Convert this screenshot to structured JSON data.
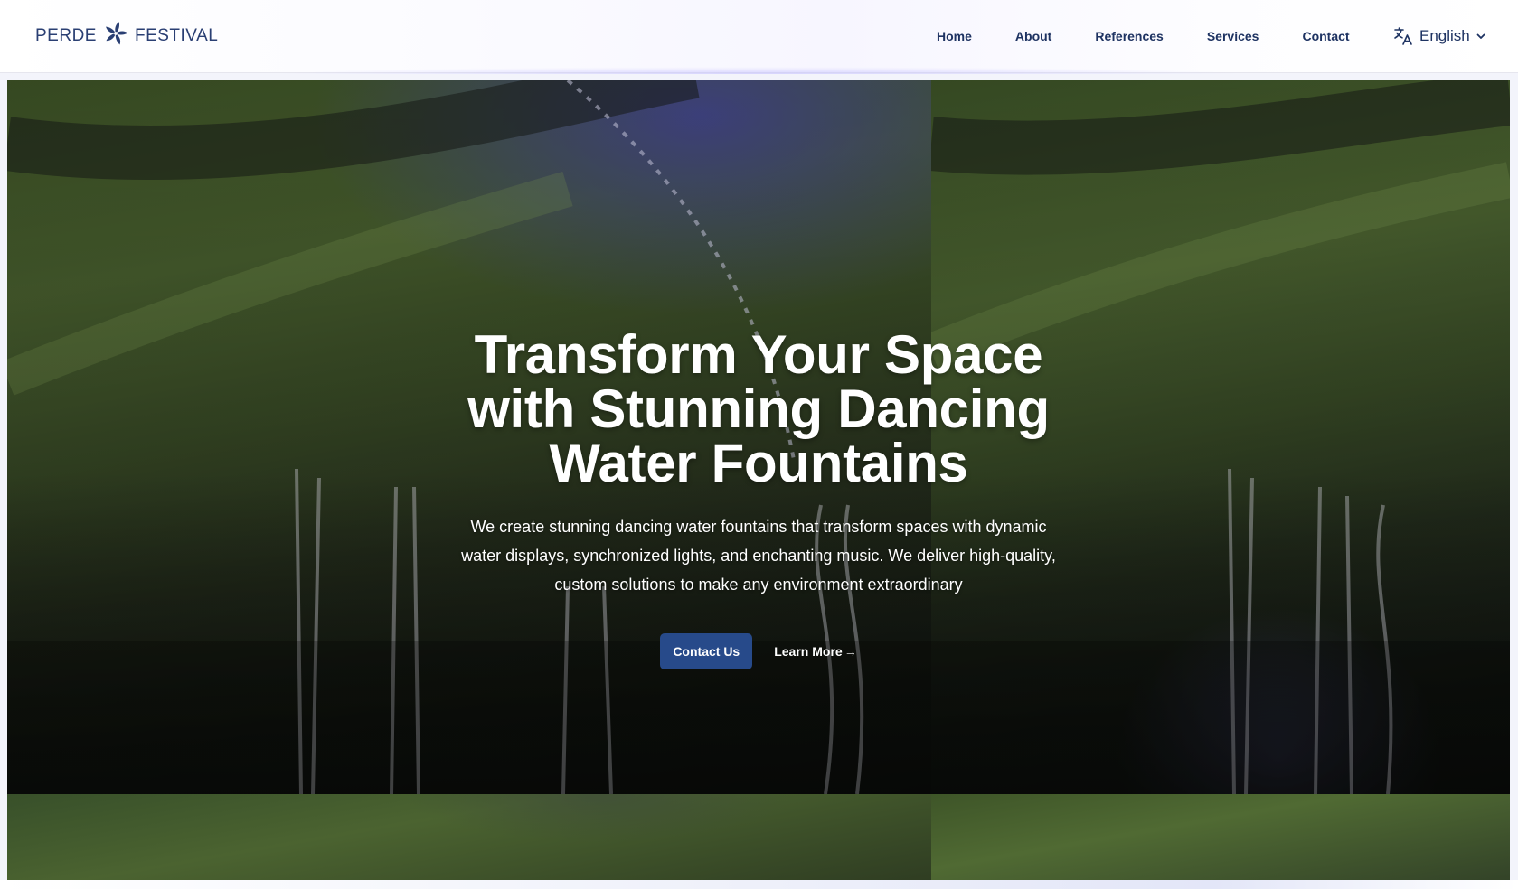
{
  "brand": {
    "left_text": "PERDE",
    "right_text": "FESTIVAL",
    "logo_icon": "pinwheel-flower-icon",
    "color": "#2a3f73"
  },
  "nav": {
    "items": [
      {
        "label": "Home"
      },
      {
        "label": "About"
      },
      {
        "label": "References"
      },
      {
        "label": "Services"
      },
      {
        "label": "Contact"
      }
    ]
  },
  "language": {
    "icon": "translate-icon",
    "selected": "English",
    "dropdown_icon": "chevron-down-icon"
  },
  "hero": {
    "title": "Transform Your Space with Stunning Dancing Water Fountains",
    "subtitle": "We create stunning dancing water fountains that transform spaces with dynamic water displays, synchronized lights, and enchanting music. We deliver high-quality, custom solutions to make any environment extraordinary",
    "primary_button": "Contact Us",
    "secondary_button": "Learn More",
    "secondary_icon": "arrow-right-icon"
  },
  "colors": {
    "accent": "#274a8a",
    "nav_text": "#1e3362"
  }
}
